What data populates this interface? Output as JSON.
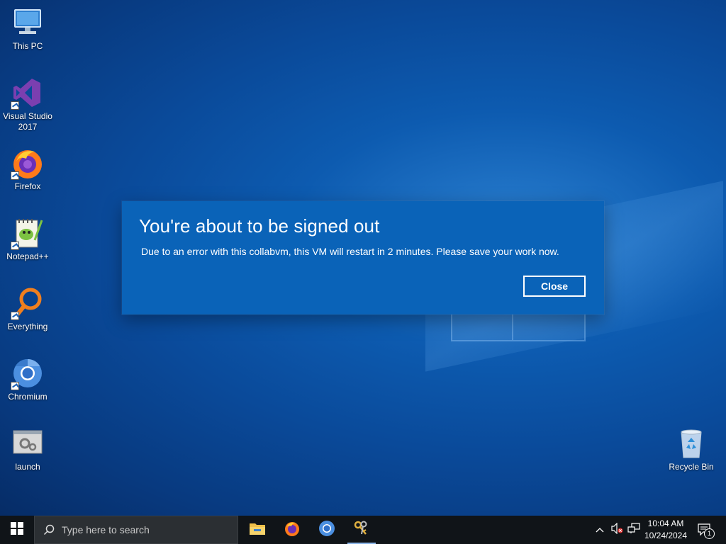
{
  "desktop": {
    "icons": [
      {
        "label": "This PC",
        "icon": "this-pc-icon"
      },
      {
        "label": "Visual Studio 2017",
        "icon": "visual-studio-icon"
      },
      {
        "label": "Firefox",
        "icon": "firefox-icon"
      },
      {
        "label": "Notepad++",
        "icon": "notepad-plus-plus-icon"
      },
      {
        "label": "Everything",
        "icon": "everything-search-icon"
      },
      {
        "label": "Chromium",
        "icon": "chromium-icon"
      },
      {
        "label": "launch",
        "icon": "launch-icon"
      },
      {
        "label": "Recycle Bin",
        "icon": "recycle-bin-icon"
      }
    ]
  },
  "dialog": {
    "title": "You're about to be signed out",
    "message": "Due to an error with this collabvm, this VM will restart in 2 minutes. Please save your work now.",
    "close_label": "Close"
  },
  "taskbar": {
    "search_placeholder": "Type here to search",
    "apps": [
      {
        "name": "File Explorer",
        "icon": "file-explorer-icon"
      },
      {
        "name": "Firefox",
        "icon": "firefox-icon"
      },
      {
        "name": "Chromium",
        "icon": "chromium-icon"
      },
      {
        "name": "Keys",
        "icon": "keys-icon"
      }
    ],
    "clock": {
      "time": "10:04 AM",
      "date": "10/24/2024"
    },
    "notification_count": "1"
  },
  "colors": {
    "dialog_bg": "#0a63b8",
    "taskbar_bg": "#101418",
    "desktop_bg": "#0a4a9a"
  }
}
